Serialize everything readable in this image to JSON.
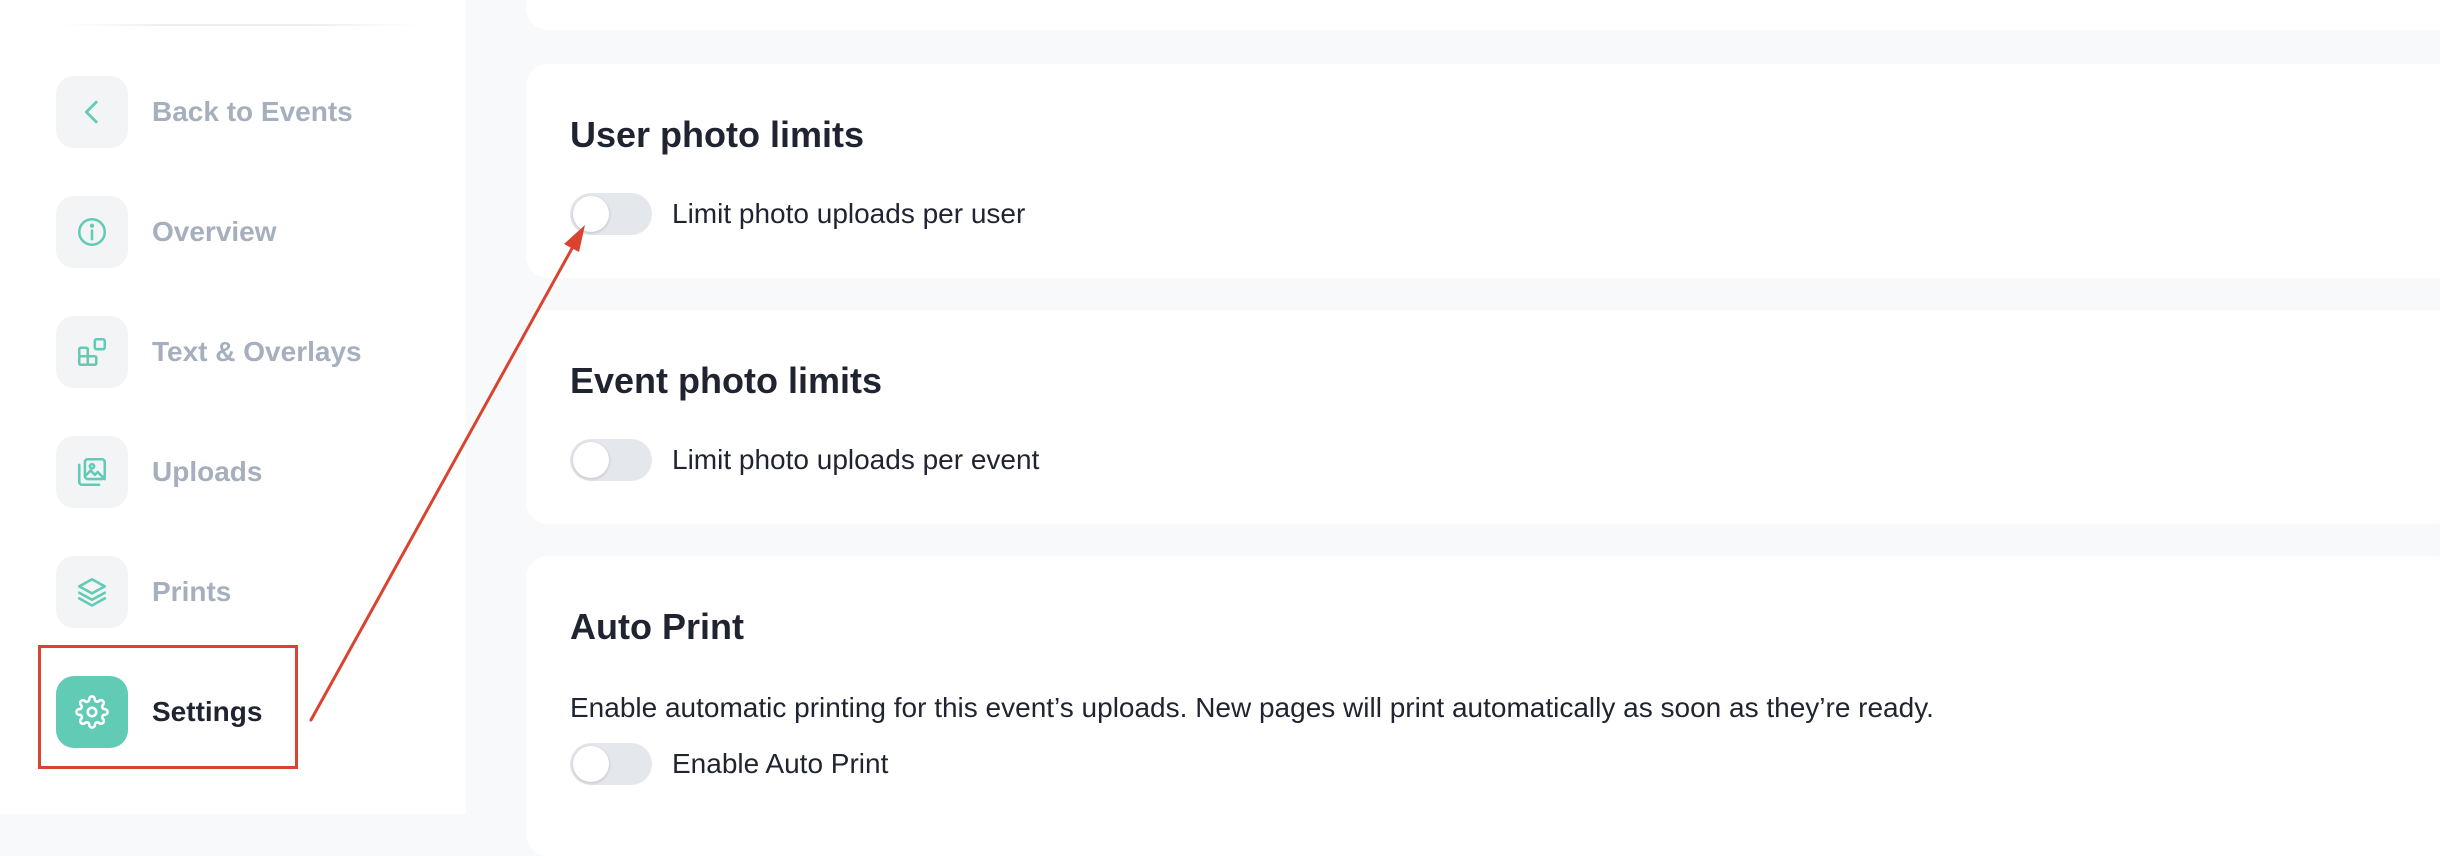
{
  "sidebar": {
    "items": [
      {
        "label": "Back to Events",
        "icon": "chevron-left-icon"
      },
      {
        "label": "Overview",
        "icon": "info-icon"
      },
      {
        "label": "Text & Overlays",
        "icon": "overlays-icon"
      },
      {
        "label": "Uploads",
        "icon": "gallery-icon"
      },
      {
        "label": "Prints",
        "icon": "layers-icon"
      },
      {
        "label": "Settings",
        "icon": "gear-icon",
        "active": true
      }
    ]
  },
  "main": {
    "sections": [
      {
        "title": "User photo limits",
        "toggle_label": "Limit photo uploads per user",
        "toggle_on": false
      },
      {
        "title": "Event photo limits",
        "toggle_label": "Limit photo uploads per event",
        "toggle_on": false
      },
      {
        "title": "Auto Print",
        "description": "Enable automatic printing for this event’s uploads. New pages will print automatically as soon as they’re ready.",
        "toggle_label": "Enable Auto Print",
        "toggle_on": false
      }
    ]
  },
  "colors": {
    "accent": "#62cbb6",
    "annotation": "#d9432f",
    "muted_text": "#a6afbd",
    "text": "#1f2430"
  }
}
